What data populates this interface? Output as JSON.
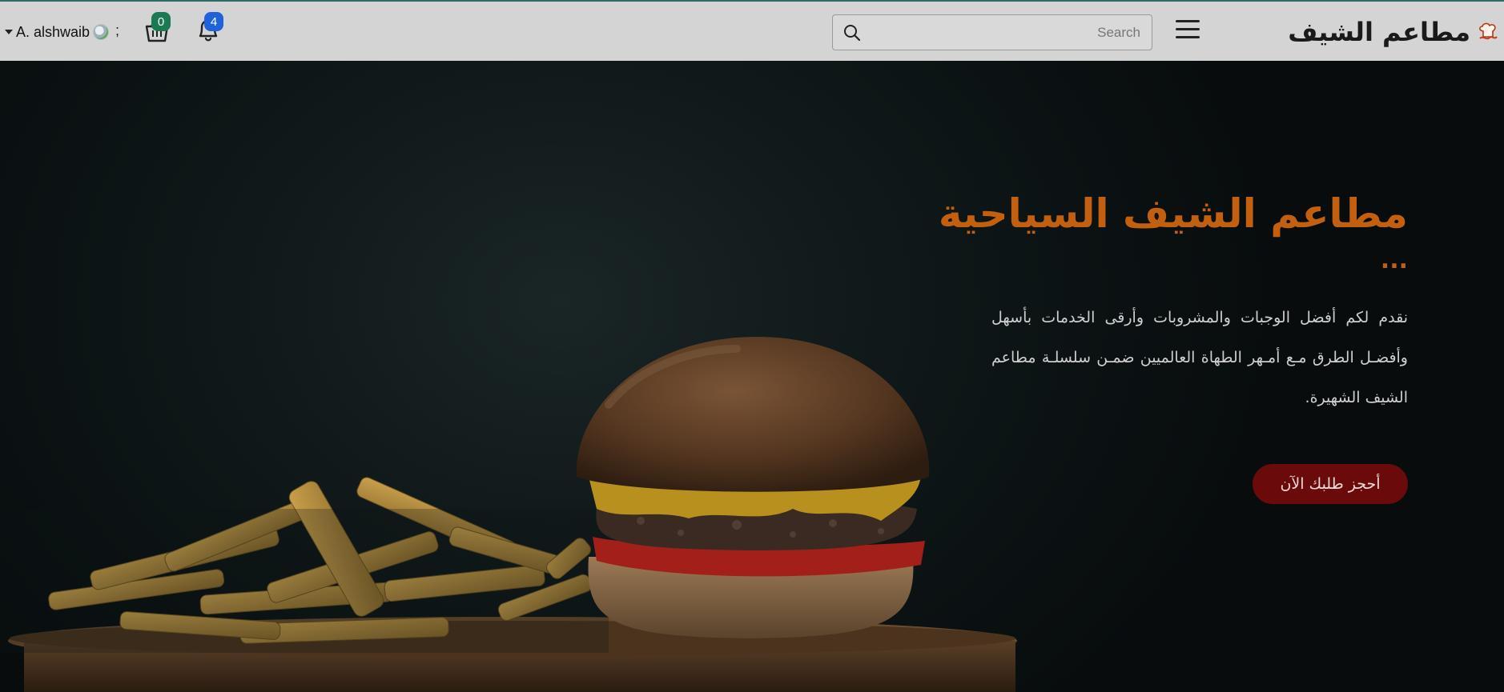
{
  "navbar": {
    "brand_name": "مطاعم الشيف",
    "brand_logo_icon": "chef-logo-icon",
    "search": {
      "placeholder": "Search",
      "value": ""
    },
    "user_name": "A. alshwaib",
    "separator_glyph": ";",
    "cart_count": "0",
    "notifications_count": "4",
    "cart_badge_color": "#1a7a52",
    "notifications_badge_color": "#1e63d8"
  },
  "hero": {
    "title": "مطاعم الشيف السياحية",
    "ellipsis": "...",
    "description": "نقدم لكم أفضل الوجبات والمشروبات وأرقى الخدمات بأسهل وأفضـل الطرق مـع أمـهر الطهاة العالميين ضمـن سلسلـة مطاعم الشيف الشهيرة.",
    "cta_label": "أحجز طلبك الآن",
    "title_color": "#c2600f",
    "cta_color": "#6b0a0a"
  }
}
